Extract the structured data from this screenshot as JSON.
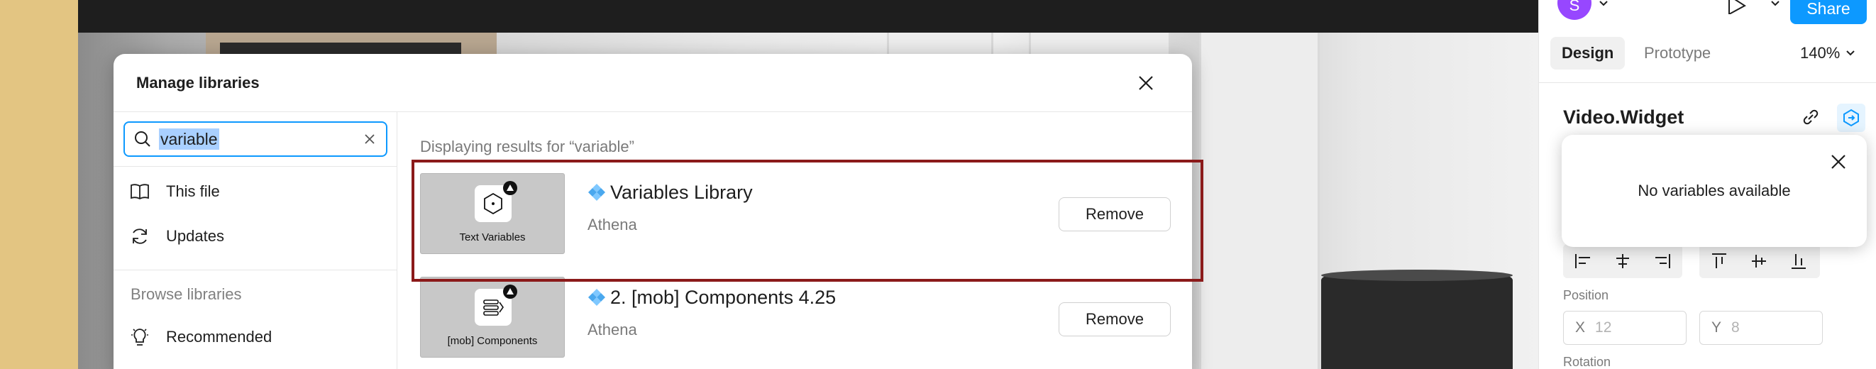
{
  "modal": {
    "title": "Manage libraries",
    "search": {
      "value": "variable"
    },
    "sidebar": {
      "this_file": "This file",
      "updates": "Updates",
      "browse_section": "Browse libraries",
      "recommended": "Recommended"
    },
    "results_caption": "Displaying results for “variable”",
    "libraries": [
      {
        "name": "Variables Library",
        "org": "Athena",
        "thumb_label": "Text Variables",
        "action": "Remove"
      },
      {
        "name": "2. [mob] Components 4.25",
        "org": "Athena",
        "thumb_label": "[mob] Components",
        "action": "Remove"
      }
    ]
  },
  "panel": {
    "avatar_initial": "S",
    "share_label": "Share",
    "tabs": [
      "Design",
      "Prototype"
    ],
    "zoom": "140%",
    "component_name": "Video.Widget",
    "variables_popover": {
      "message": "No variables available"
    },
    "position_label": "Position",
    "x_axis": "X",
    "x_value": "12",
    "y_axis": "Y",
    "y_value": "8",
    "rotation_label": "Rotation"
  },
  "colors": {
    "accent": "#0d99ff",
    "highlight": "#8b1a1a",
    "avatar": "#9747ff"
  }
}
